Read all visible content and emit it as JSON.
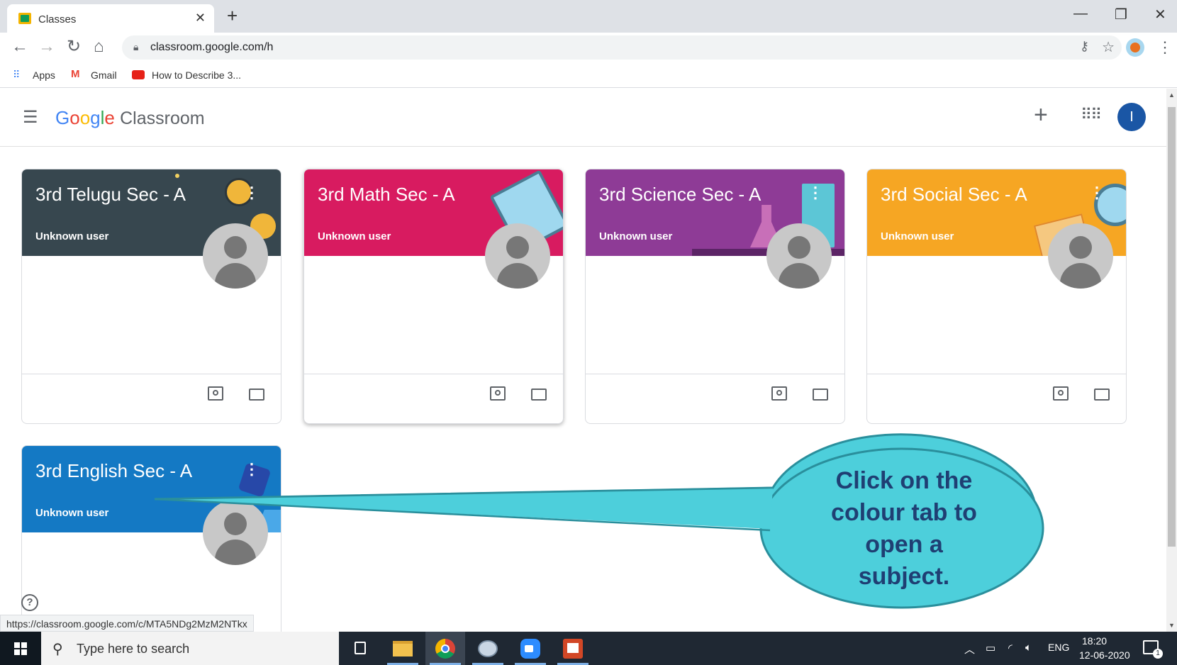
{
  "browser": {
    "tab_title": "Classes",
    "url": "classroom.google.com/h",
    "bookmarks": [
      {
        "label": "Apps",
        "icon": "apps-grid-icon"
      },
      {
        "label": "Gmail",
        "icon": "gmail-icon"
      },
      {
        "label": "How to Describe 3...",
        "icon": "youtube-icon"
      }
    ]
  },
  "header": {
    "logo_google": "Google",
    "logo_product": "Classroom",
    "account_initial": "I"
  },
  "classes": [
    {
      "title": "3rd Telugu Sec - A",
      "owner": "Unknown user",
      "color": "#37474f"
    },
    {
      "title": "3rd Math Sec - A",
      "owner": "Unknown user",
      "color": "#d81b60"
    },
    {
      "title": "3rd Science Sec - A",
      "owner": "Unknown user",
      "color": "#8e3b96"
    },
    {
      "title": "3rd Social Sec - A",
      "owner": "Unknown user",
      "color": "#f6a623"
    },
    {
      "title": "3rd English Sec - A",
      "owner": "Unknown user",
      "color": "#1479c4"
    }
  ],
  "callout": {
    "text": "Click on the colour tab to open a subject.",
    "lines": [
      "Click on the",
      "colour tab to",
      "open a",
      "subject."
    ],
    "fill": "#4dcfdb",
    "text_color": "#1f3f73"
  },
  "status_url": "https://classroom.google.com/c/MTA5NDg2MzM2NTkx",
  "help_label": "?",
  "taskbar": {
    "search_placeholder": "Type here to search",
    "language": "ENG",
    "time": "18:20",
    "date": "12-06-2020",
    "notification_count": "1"
  }
}
